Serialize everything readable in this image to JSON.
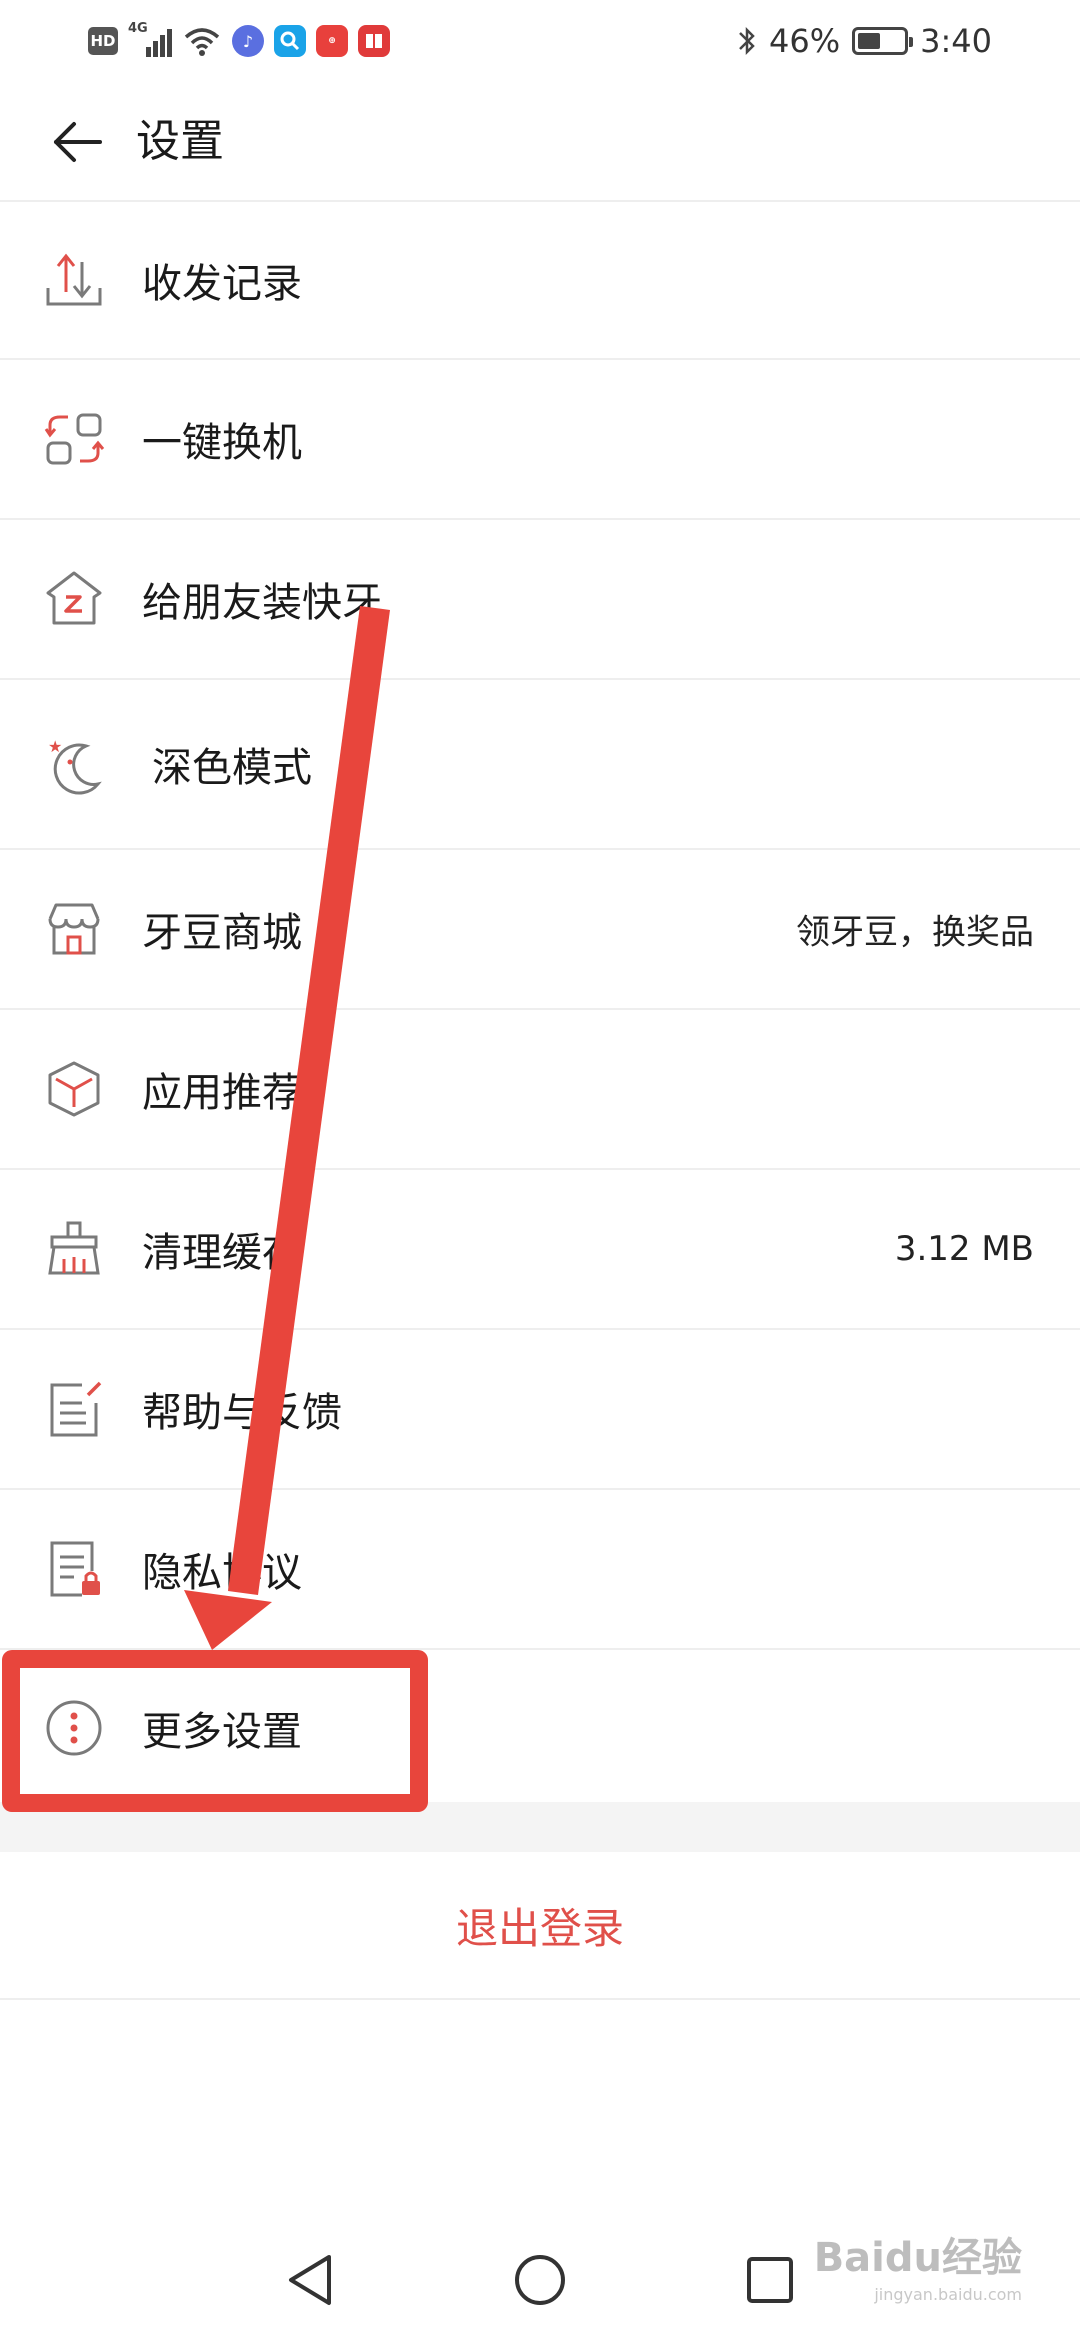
{
  "status_bar": {
    "hd": "HD",
    "network": "4G",
    "battery_percent": "46%",
    "battery_level": 0.46,
    "time": "3:40",
    "app_icons": [
      "music-app-icon",
      "search-app-icon",
      "huawei-appgallery-icon",
      "books-app-icon"
    ],
    "app_icon_colors": [
      "#5a6fe0",
      "#1aa3e8",
      "#e8403c",
      "#e03a3a"
    ]
  },
  "header": {
    "title": "设置",
    "back_icon": "back-arrow-icon"
  },
  "settings": {
    "items": [
      {
        "label": "收发记录",
        "value": "",
        "icon": "transfer-record-icon"
      },
      {
        "label": "一键换机",
        "value": "",
        "icon": "phone-clone-icon"
      },
      {
        "label": "给朋友装快牙",
        "value": "",
        "icon": "install-for-friend-icon"
      },
      {
        "label": "深色模式",
        "value": "",
        "icon": "dark-mode-moon-icon"
      },
      {
        "label": "牙豆商城",
        "value": "领牙豆，换奖品",
        "icon": "store-icon"
      },
      {
        "label": "应用推荐",
        "value": "",
        "icon": "app-recommend-box-icon"
      },
      {
        "label": "清理缓存",
        "value": "3.12 MB",
        "icon": "clean-cache-broom-icon"
      },
      {
        "label": "帮助与反馈",
        "value": "",
        "icon": "help-feedback-icon"
      },
      {
        "label": "隐私协议",
        "value": "",
        "icon": "privacy-policy-icon"
      },
      {
        "label": "更多设置",
        "value": "",
        "icon": "more-settings-icon"
      }
    ]
  },
  "logout": {
    "label": "退出登录"
  },
  "nav": {
    "back": "nav-back-icon",
    "home": "nav-home-icon",
    "recents": "nav-recents-icon"
  },
  "watermark": {
    "text": "Baidu经验",
    "sub": "jingyan.baidu.com"
  },
  "colors": {
    "accent": "#e0504a",
    "annotation": "#e8453c",
    "icon_gray": "#7a7a7a"
  }
}
